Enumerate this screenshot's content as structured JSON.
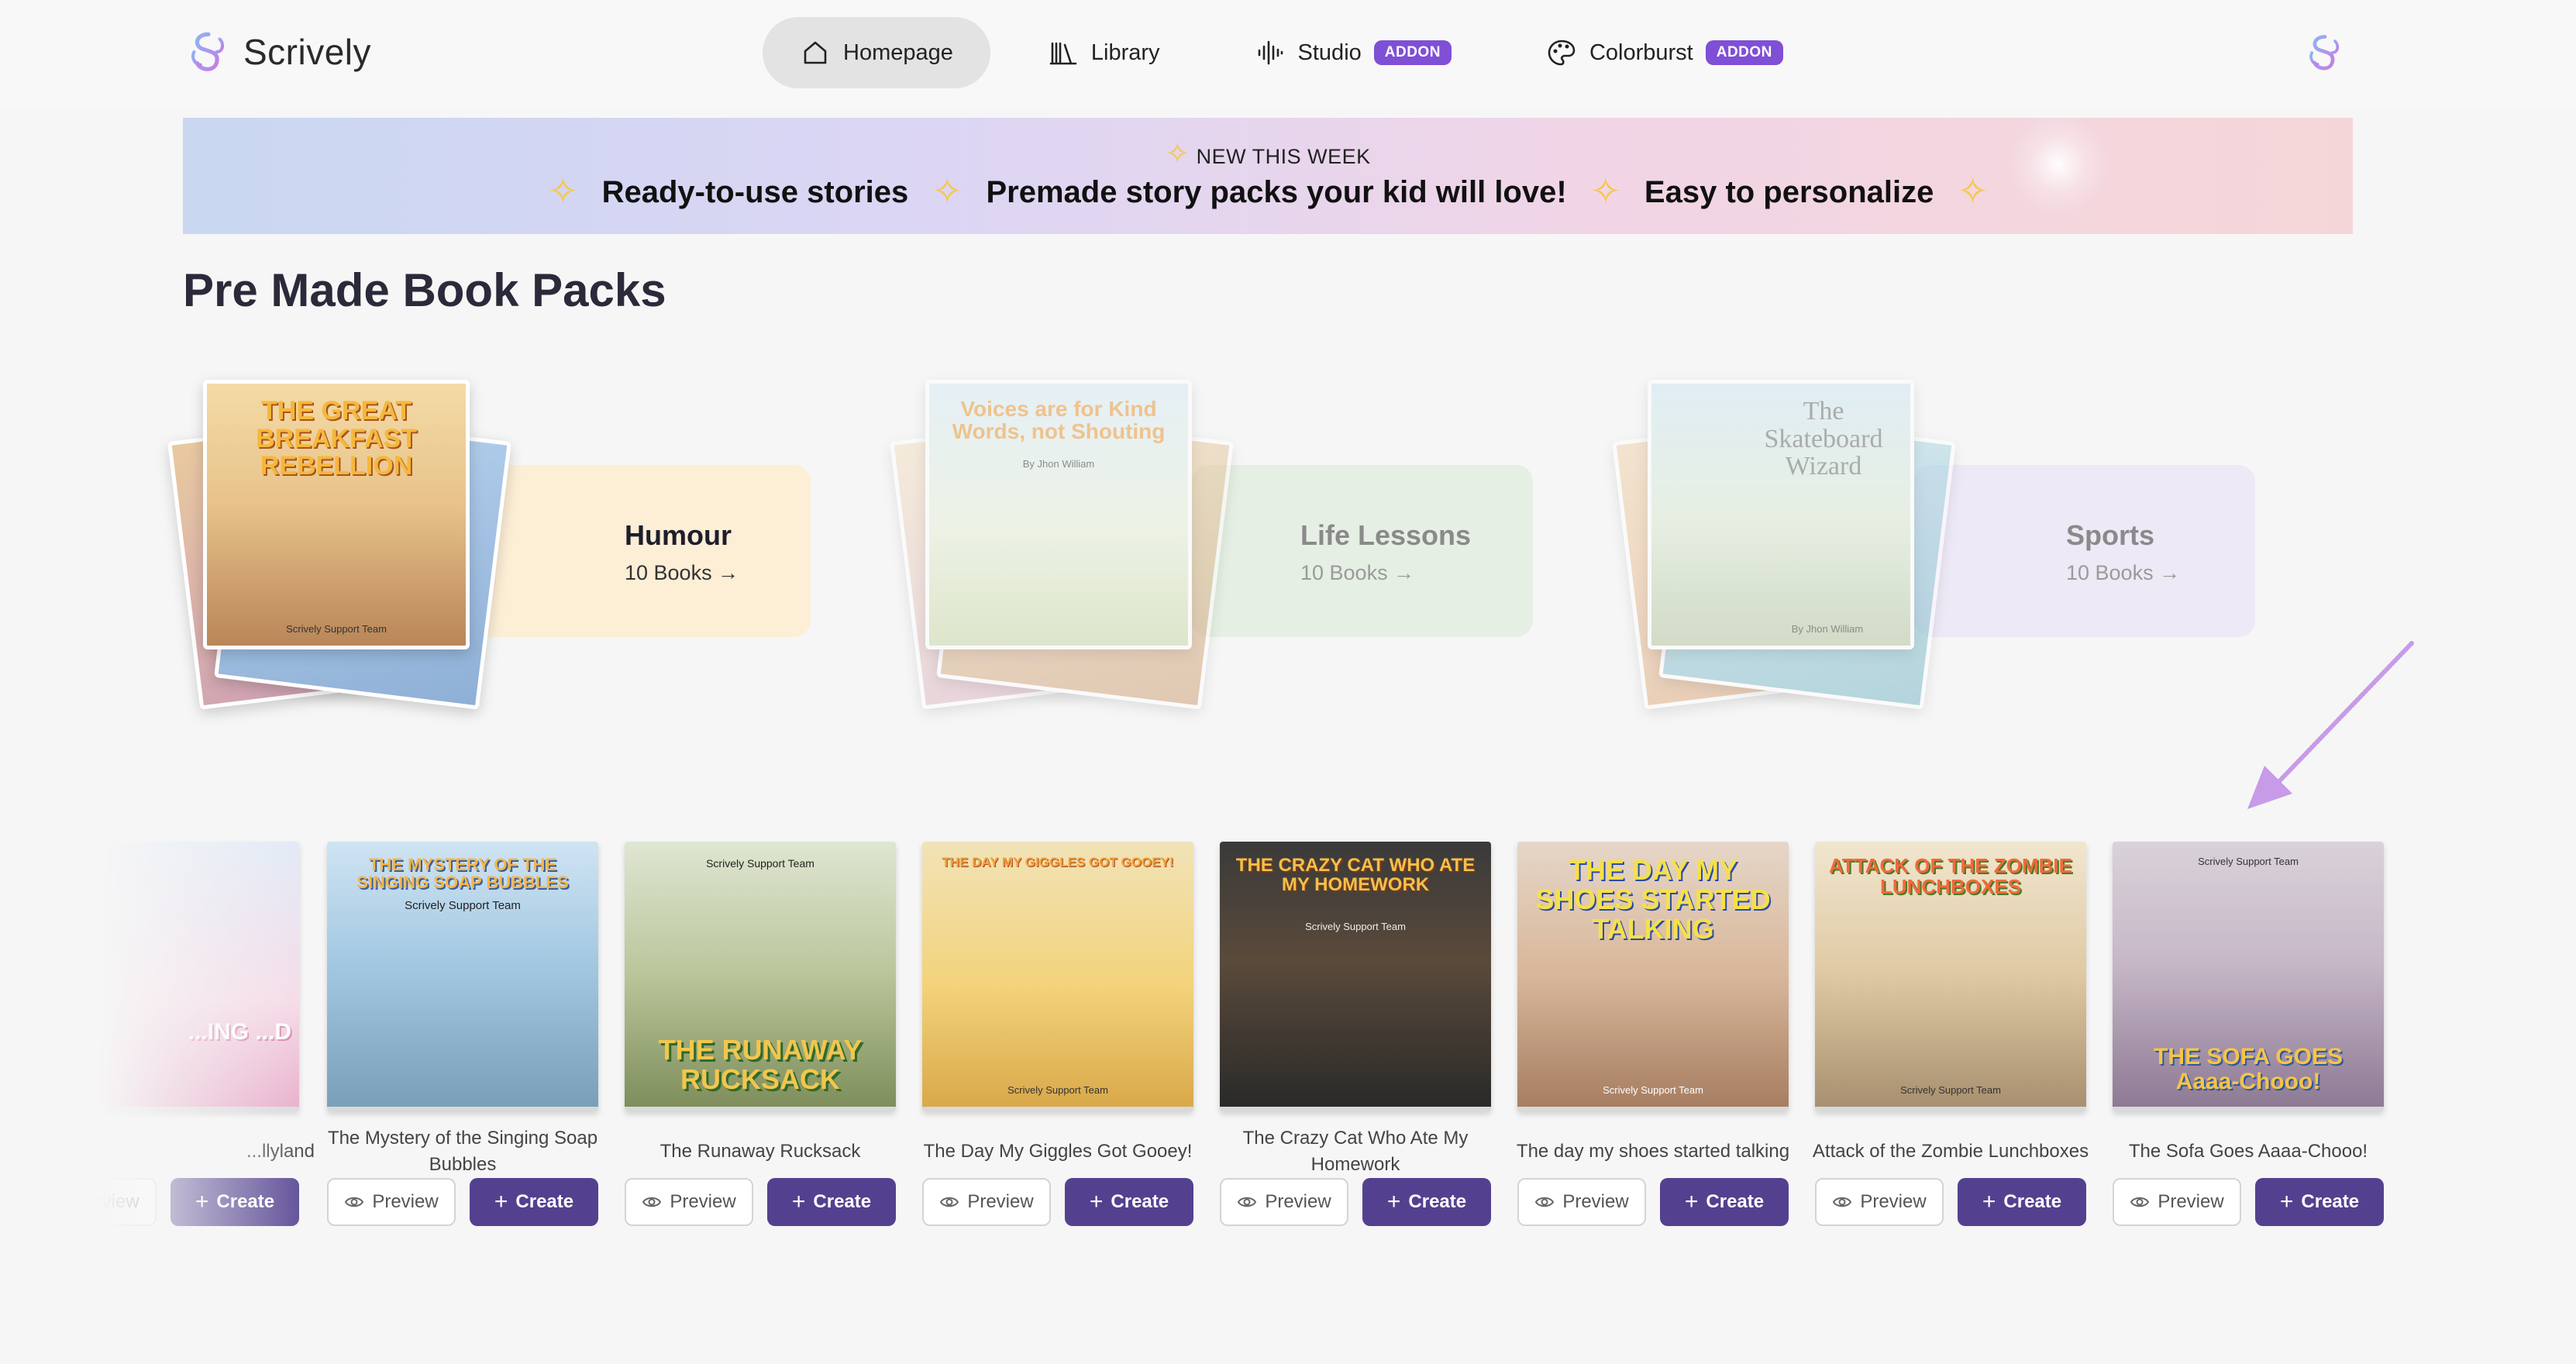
{
  "app": {
    "name": "Scrively"
  },
  "nav": [
    {
      "label": "Homepage",
      "icon": "home-icon",
      "active": true,
      "badge": ""
    },
    {
      "label": "Library",
      "icon": "library-icon",
      "active": false,
      "badge": ""
    },
    {
      "label": "Studio",
      "icon": "audio-wave-icon",
      "active": false,
      "badge": "ADDON"
    },
    {
      "label": "Colorburst",
      "icon": "palette-icon",
      "active": false,
      "badge": "ADDON"
    }
  ],
  "banner": {
    "subtitle": "NEW THIS WEEK",
    "items": [
      "Ready-to-use stories",
      "Premade story packs your kid will love!",
      "Easy to personalize"
    ]
  },
  "section": {
    "title": "Pre Made Book Packs"
  },
  "packs": [
    {
      "name": "Humour",
      "count": "10 Books →",
      "cover_title": "THE GREAT BREAKFAST REBELLION",
      "cover_author": "Scrively Support Team",
      "color": "#fdeed6"
    },
    {
      "name": "Life Lessons",
      "count": "10 Books →",
      "cover_title": "Voices are for Kind Words, not Shouting",
      "cover_author": "By Jhon William",
      "color": "#e6efe4"
    },
    {
      "name": "Sports",
      "count": "10 Books →",
      "cover_title": "The Skateboard Wizard",
      "cover_author": "By Jhon William",
      "color": "#eee9f6"
    }
  ],
  "books": [
    {
      "title": "...llyland",
      "cover_title": "...ING ...D",
      "cover_author": ""
    },
    {
      "title": "The Mystery of the Singing Soap Bubbles",
      "cover_title": "THE MYSTERY OF THE SINGING SOAP BUBBLES",
      "cover_author": "Scrively Support Team"
    },
    {
      "title": "The Runaway Rucksack",
      "cover_title": "THE RUNAWAY RUCKSACK",
      "cover_author": "Scrively Support Team"
    },
    {
      "title": "The Day My Giggles Got Gooey!",
      "cover_title": "THE DAY MY GIGGLES GOT GOOEY!",
      "cover_author": "Scrively Support Team"
    },
    {
      "title": "The Crazy Cat Who Ate My Homework",
      "cover_title": "THE CRAZY CAT WHO ATE MY HOMEWORK",
      "cover_author": "Scrively Support Team"
    },
    {
      "title": "The day my shoes started talking",
      "cover_title": "THE DAY MY SHOES STARTED TALKING",
      "cover_author": "Scrively Support Team"
    },
    {
      "title": "Attack of the Zombie Lunchboxes",
      "cover_title": "ATTACK OF THE ZOMBIE LUNCHBOXES",
      "cover_author": "Scrively Support Team"
    },
    {
      "title": "The Sofa Goes Aaaa-Chooo!",
      "cover_title": "THE SOFA GOES Aaaa-Chooo!",
      "cover_author": "Scrively Support Team"
    }
  ],
  "actions": {
    "preview": "Preview",
    "create": "Create"
  },
  "colors": {
    "accent": "#53418f",
    "badge": "#7f4fd6"
  }
}
